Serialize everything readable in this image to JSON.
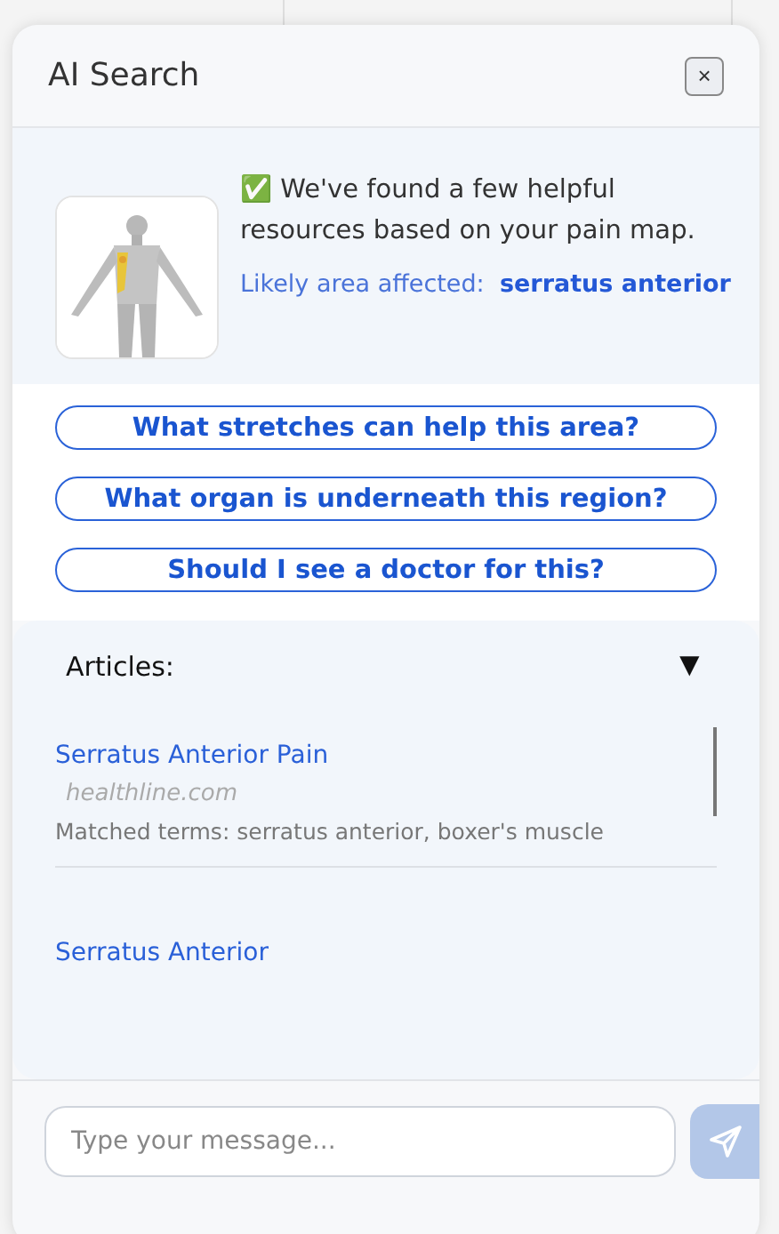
{
  "panel": {
    "title": "AI Search",
    "close": "×"
  },
  "summary": {
    "check": "✅",
    "message": "We've found a few helpful resources based on your pain map.",
    "area_label": "Likely area affected:",
    "area_value": "serratus anterior"
  },
  "suggestions": [
    "What stretches can help this area?",
    "What organ is underneath this region?",
    "Should I see a doctor for this?"
  ],
  "articles": {
    "heading": "Articles:",
    "toggle": "▼",
    "expanded": true,
    "items": [
      {
        "title": "Serratus Anterior Pain",
        "source": "healthline.com",
        "matched": "Matched terms: serratus anterior, boxer's muscle"
      },
      {
        "title": "Serratus Anterior"
      }
    ]
  },
  "composer": {
    "placeholder": "Type your message..."
  }
}
